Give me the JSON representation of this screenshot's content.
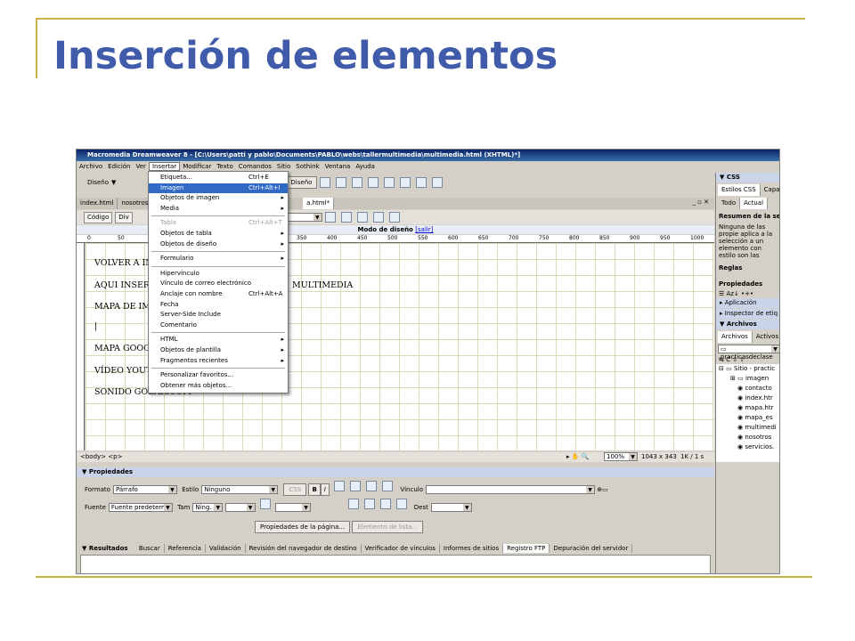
{
  "slide": {
    "title": "Inserción de elementos"
  },
  "window": {
    "title": "Macromedia Dreamweaver 8 - [C:\\Users\\patti y pablo\\Documents\\PABLO\\webs\\tallermultimedia\\multimedia.html (XHTML)*]"
  },
  "menubar": [
    "Archivo",
    "Edición",
    "Ver",
    "Insertar",
    "Modificar",
    "Texto",
    "Comandos",
    "Sitio",
    "Sothink",
    "Ventana",
    "Ayuda"
  ],
  "toolbar": {
    "mode": "Diseño",
    "diseno_btn": "Diseño"
  },
  "doc_tabs": [
    "index.html",
    "nosotros..."
  ],
  "doc_tab_active": "a.html*",
  "codebar": {
    "code": "Código",
    "split": "Div"
  },
  "modebar": {
    "label": "Modo de diseño",
    "exit": "[salir]"
  },
  "ruler": [
    "0",
    "50",
    "350",
    "400",
    "450",
    "500",
    "550",
    "600",
    "650",
    "700",
    "750",
    "800",
    "850",
    "900",
    "950",
    "1000"
  ],
  "document": {
    "lines": [
      "VOLVER A IN",
      "AQUI INSERT",
      "MULTIMEDIA",
      "MAPA DE IM",
      "|",
      "MAPA GOOG",
      "VÍDEO YOUT",
      "SONIDO GOEAR.COM"
    ]
  },
  "status": {
    "tags": "<body> <p>",
    "zoom": "100%",
    "size": "1043 x 343",
    "file": "1K / 1 s"
  },
  "menu": [
    {
      "label": "Etiqueta...",
      "shortcut": "Ctrl+E"
    },
    {
      "label": "Imagen",
      "shortcut": "Ctrl+Alt+I",
      "highlight": true
    },
    {
      "label": "Objetos de imagen",
      "sub": true
    },
    {
      "label": "Media",
      "sub": true
    },
    {
      "sep": true
    },
    {
      "label": "Tabla",
      "shortcut": "Ctrl+Alt+T",
      "disabled": true
    },
    {
      "label": "Objetos de tabla",
      "sub": true
    },
    {
      "label": "Objetos de diseño",
      "sub": true
    },
    {
      "sep": true
    },
    {
      "label": "Formulario",
      "sub": true
    },
    {
      "sep": true
    },
    {
      "label": "Hipervínculo"
    },
    {
      "label": "Vínculo de correo electrónico"
    },
    {
      "label": "Anclaje con nombre",
      "shortcut": "Ctrl+Alt+A"
    },
    {
      "label": "Fecha"
    },
    {
      "label": "Server-Side Include"
    },
    {
      "label": "Comentario"
    },
    {
      "sep": true
    },
    {
      "label": "HTML",
      "sub": true
    },
    {
      "label": "Objetos de plantilla",
      "sub": true
    },
    {
      "label": "Fragmentos recientes",
      "sub": true
    },
    {
      "sep": true
    },
    {
      "label": "Personalizar favoritos..."
    },
    {
      "label": "Obtener más objetos..."
    }
  ],
  "props": {
    "header": "Propiedades",
    "formato_label": "Formato",
    "formato": "Párrafo",
    "estilo_label": "Estilo",
    "estilo": "Ninguno",
    "css": "CSS",
    "bold": "B",
    "italic": "I",
    "vinculo_label": "Vínculo",
    "fuente_label": "Fuente",
    "fuente": "Fuente predeterm",
    "tam_label": "Tam",
    "tam": "Ning.",
    "dest_label": "Dest",
    "page_props": "Propiedades de la página...",
    "list_item": "Elemento de lista..."
  },
  "results": {
    "header": "Resultados",
    "tabs": [
      "Buscar",
      "Referencia",
      "Validación",
      "Revisión del navegador de destino",
      "Verificador de vínculos",
      "Informes de sitios",
      "Registro FTP",
      "Depuración del servidor"
    ]
  },
  "right": {
    "css_header": "CSS",
    "css_tabs": [
      "Estilos CSS",
      "Capas"
    ],
    "css_sub": [
      "Todo",
      "Actual"
    ],
    "summary_header": "Resumen de la selecci",
    "summary_text": "Ninguna de las propie aplica a la selección a un elemento con estilo son las propiedades C",
    "rules": "Reglas",
    "properties": "Propiedades",
    "aplicacion": "Aplicación",
    "inspector": "Inspector de etiq",
    "files_header": "Archivos",
    "files_tabs": [
      "Archivos",
      "Activos"
    ],
    "site": "practicasdeclase",
    "root": "Sitio - practic",
    "tree": [
      "imagen",
      "contacto",
      "index.htr",
      "mapa.htr",
      "mapa_es",
      "multimedi",
      "nosotros",
      "servicios."
    ]
  }
}
